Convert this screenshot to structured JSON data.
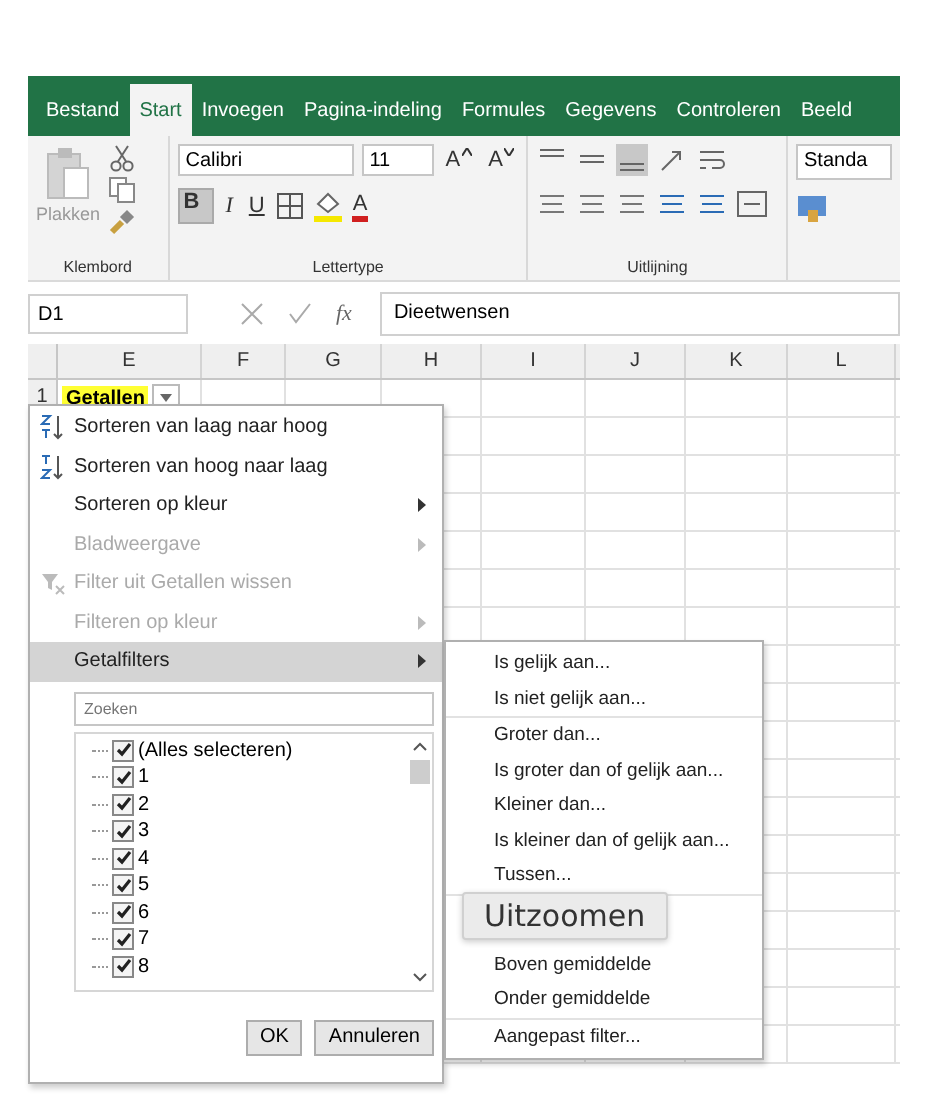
{
  "tabs": [
    {
      "label": "Bestand",
      "selected": false
    },
    {
      "label": "Start",
      "selected": true
    },
    {
      "label": "Invoegen",
      "selected": false
    },
    {
      "label": "Pagina-indeling",
      "selected": false
    },
    {
      "label": "Formules",
      "selected": false
    },
    {
      "label": "Gegevens",
      "selected": false
    },
    {
      "label": "Controleren",
      "selected": false
    },
    {
      "label": "Beeld",
      "selected": false
    }
  ],
  "ribbon": {
    "paste_label": "Plakken",
    "font_name": "Calibri",
    "font_size": "11",
    "grow_label": "A",
    "shrink_label": "A",
    "bold": "B",
    "italic": "I",
    "underline": "U",
    "font_color_label": "A",
    "number_format": "Standa",
    "groups": [
      "Klembord",
      "Lettertype",
      "Uitlijning"
    ]
  },
  "formula_bar": {
    "name_box": "D1",
    "fx": "fx",
    "value": "Dieetwensen"
  },
  "columns": [
    "E",
    "F",
    "G",
    "H",
    "I",
    "J",
    "K",
    "L"
  ],
  "rows": [
    {
      "number": "1",
      "cell": "Getallen"
    }
  ],
  "filter_menu": {
    "items": [
      {
        "label": "Sorteren van laag naar hoog",
        "kind": "sort-asc",
        "disabled": false,
        "submenu": false,
        "selected": false
      },
      {
        "label": "Sorteren van hoog naar laag",
        "kind": "sort-desc",
        "disabled": false,
        "submenu": false,
        "selected": false
      },
      {
        "label": "Sorteren op kleur",
        "kind": "plain",
        "disabled": false,
        "submenu": true,
        "selected": false
      },
      {
        "label": "Bladweergave",
        "kind": "plain",
        "disabled": true,
        "submenu": true,
        "selected": false
      },
      {
        "label": "Filter uit Getallen wissen",
        "kind": "clear-filter",
        "disabled": true,
        "submenu": false,
        "selected": false
      },
      {
        "label": "Filteren op kleur",
        "kind": "plain",
        "disabled": true,
        "submenu": true,
        "selected": false
      },
      {
        "label": "Getalfilters",
        "kind": "plain",
        "disabled": false,
        "submenu": true,
        "selected": true
      }
    ],
    "search": {
      "placeholder": "Zoeken"
    },
    "values": [
      {
        "label": "(Alles selecteren)",
        "checked": true
      },
      {
        "label": "1",
        "checked": true
      },
      {
        "label": "2",
        "checked": true
      },
      {
        "label": "3",
        "checked": true
      },
      {
        "label": "4",
        "checked": true
      },
      {
        "label": "5",
        "checked": true
      },
      {
        "label": "6",
        "checked": true
      },
      {
        "label": "7",
        "checked": true
      },
      {
        "label": "8",
        "checked": true
      }
    ],
    "buttons": [
      "OK",
      "Annuleren"
    ]
  },
  "number_filters": [
    {
      "label": "Is gelijk aan...",
      "divider_after": false
    },
    {
      "label": "Is niet gelijk aan...",
      "divider_after": true
    },
    {
      "label": "Groter dan...",
      "divider_after": false
    },
    {
      "label": "Is groter dan of gelijk aan...",
      "divider_after": false
    },
    {
      "label": "Kleiner dan...",
      "divider_after": false
    },
    {
      "label": "Is kleiner dan of gelijk aan...",
      "divider_after": false
    },
    {
      "label": "Tussen...",
      "divider_after": true
    },
    {
      "label": "Boven gemiddelde",
      "divider_after": false
    },
    {
      "label": "Onder gemiddelde",
      "divider_after": true
    },
    {
      "label": "Aangepast filter...",
      "divider_after": false
    }
  ],
  "tooltip": "Uitzoomen"
}
